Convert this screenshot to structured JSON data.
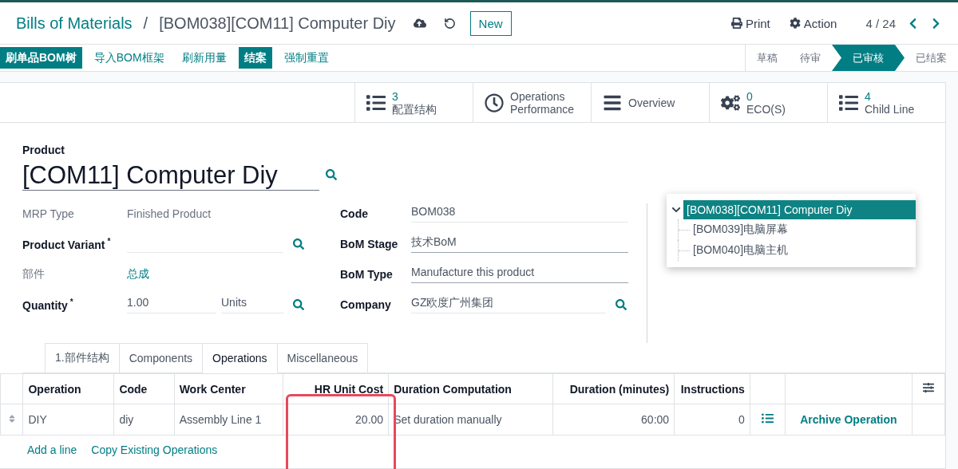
{
  "breadcrumb": {
    "parent": "Bills of Materials",
    "separator": "/",
    "current": "[BOM038][COM11] Computer Diy"
  },
  "header_actions": {
    "new": "New",
    "print": "Print",
    "action": "Action",
    "pager": "4 / 24"
  },
  "toolbar_buttons": [
    {
      "label": "刷单品BOM树",
      "primary": true
    },
    {
      "label": "导入BOM框架",
      "primary": false
    },
    {
      "label": "刷新用量",
      "primary": false
    },
    {
      "label": "结案",
      "primary": true
    },
    {
      "label": "强制重置",
      "primary": false
    }
  ],
  "status_steps": [
    {
      "label": "草稿",
      "selected": false
    },
    {
      "label": "待审",
      "selected": false
    },
    {
      "label": "已审核",
      "selected": true
    },
    {
      "label": "已结案",
      "selected": false
    }
  ],
  "smart_buttons": [
    {
      "value": "3",
      "label": "配置结构"
    },
    {
      "label": "Operations Performance"
    },
    {
      "label": "Overview"
    },
    {
      "value": "0",
      "label": "ECO(S)"
    },
    {
      "value": "4",
      "label": "Child Line"
    }
  ],
  "product": {
    "label": "Product",
    "value": "[COM11] Computer Diy"
  },
  "left_fields": [
    {
      "kind": "readonly",
      "label": "MRP Type",
      "value": "Finished Product"
    },
    {
      "kind": "many2one",
      "label": "Product Variant",
      "required_mark": "*"
    },
    {
      "kind": "link",
      "label": "部件",
      "value": "总成"
    },
    {
      "kind": "quantity",
      "label": "Quantity",
      "required_mark": "*",
      "value": "1.00",
      "unit": "Units"
    }
  ],
  "right_fields": [
    {
      "kind": "text",
      "label": "Code",
      "value": "BOM038"
    },
    {
      "kind": "select",
      "label": "BoM Stage",
      "value": "技术BoM"
    },
    {
      "kind": "select",
      "label": "BoM Type",
      "value": "Manufacture this product"
    },
    {
      "kind": "many2one",
      "label": "Company",
      "value": "GZ欧度广州集团"
    }
  ],
  "tree": {
    "label": "[BOM038][COM11] Computer Diy",
    "expanded": true,
    "selected": true,
    "children": [
      {
        "label": "[BOM039]电脑屏幕",
        "selected": false
      },
      {
        "label": "[BOM040]电脑主机",
        "selected": false
      }
    ]
  },
  "tabs": [
    {
      "label": "1.部件结构",
      "selected": false
    },
    {
      "label": "Components",
      "selected": false
    },
    {
      "label": "Operations",
      "selected": true
    },
    {
      "label": "Miscellaneous",
      "selected": false
    }
  ],
  "table": {
    "columns": [
      "Operation",
      "Code",
      "Work Center",
      "HR Unit Cost",
      "Duration Computation",
      "Duration (minutes)",
      "Instructions"
    ],
    "rows": [
      {
        "cells": [
          "DIY",
          "diy",
          "Assembly Line 1",
          "20.00",
          "Set duration manually",
          "60:00",
          "0"
        ],
        "action": "Archive Operation"
      }
    ]
  },
  "table_links": [
    "Add a line",
    "Copy Existing Operations"
  ],
  "annotation": {
    "kind": "highlight"
  }
}
